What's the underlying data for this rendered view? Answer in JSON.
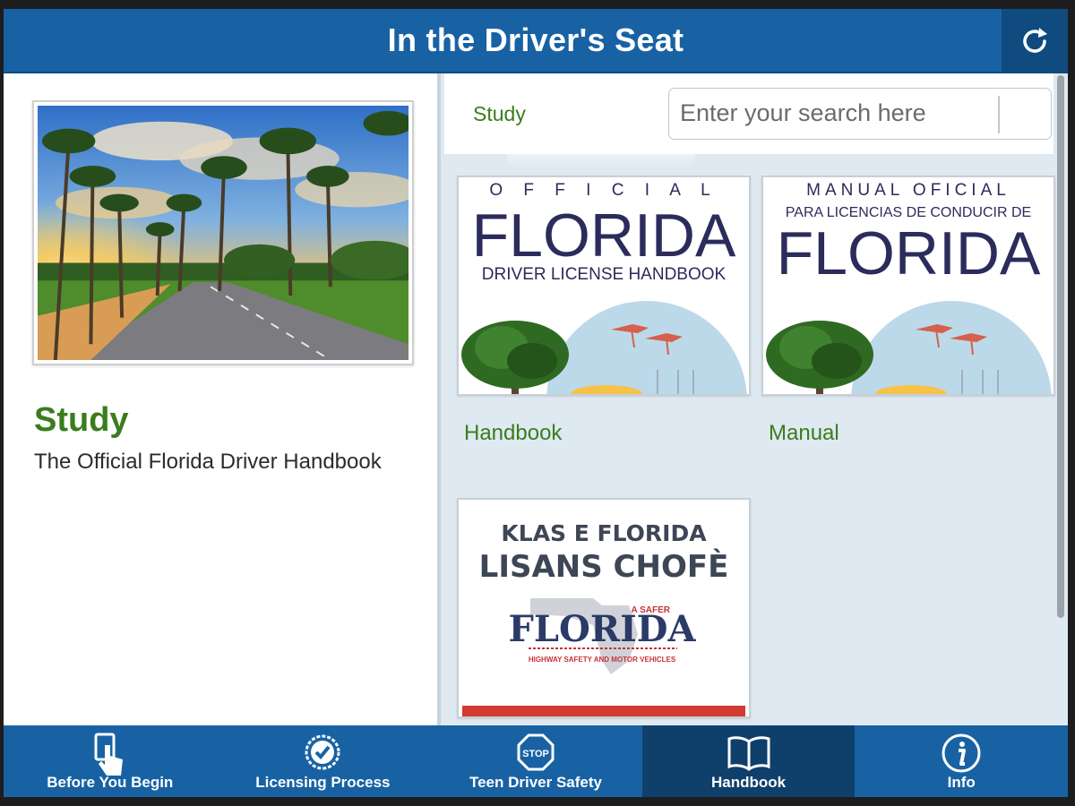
{
  "header": {
    "title": "In the Driver's Seat",
    "refresh_icon": "refresh-icon"
  },
  "left_panel": {
    "hero_image": "palm-tree-road-sunset",
    "title": "Study",
    "subtitle": "The Official Florida Driver Handbook"
  },
  "right_panel": {
    "section_label": "Study",
    "search": {
      "placeholder": "Enter your search here",
      "value": ""
    },
    "tiles": [
      {
        "label": "Handbook",
        "cover": {
          "top_line": "O F F I C I A L",
          "big_title": "FLORIDA",
          "subtitle": "DRIVER LICENSE HANDBOOK"
        }
      },
      {
        "label": "Manual",
        "cover": {
          "top_line": "MANUAL OFICIAL",
          "subtitle": "PARA LICENCIAS DE CONDUCIR DE",
          "big_title": "FLORIDA"
        }
      },
      {
        "label": "",
        "cover": {
          "line1": "KLAS E FLORIDA",
          "line2": "LISANS CHOFÈ",
          "logo_small": "A SAFER",
          "logo_big": "FLORIDA",
          "logo_sub": "HIGHWAY SAFETY AND MOTOR VEHICLES"
        }
      }
    ]
  },
  "nav": {
    "items": [
      {
        "label": "Before You Begin",
        "icon": "hand-tap-icon",
        "active": false
      },
      {
        "label": "Licensing Process",
        "icon": "badge-check-icon",
        "active": false
      },
      {
        "label": "Teen Driver Safety",
        "icon": "stop-sign-icon",
        "active": false
      },
      {
        "label": "Handbook",
        "icon": "open-book-icon",
        "active": true
      },
      {
        "label": "Info",
        "icon": "info-icon",
        "active": false
      }
    ]
  },
  "colors": {
    "primary_blue": "#1862a4",
    "active_tab": "#0f3f6b",
    "accent_green": "#3a7d1d",
    "panel_bg": "#dfe9f1",
    "cover_navy": "#2b2b5c"
  }
}
